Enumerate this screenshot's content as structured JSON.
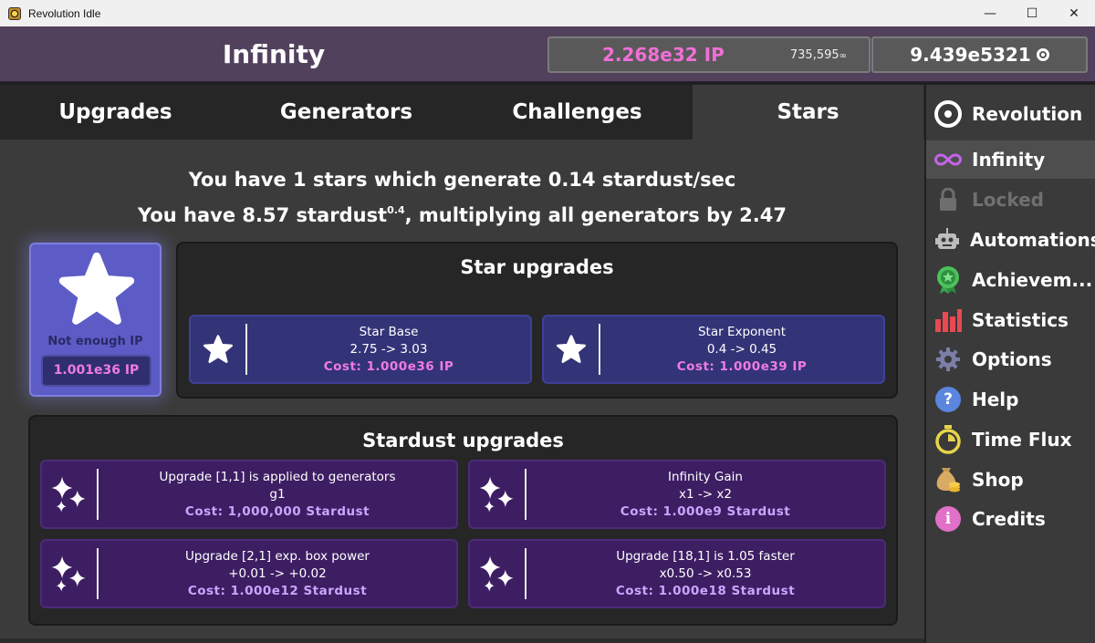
{
  "window": {
    "title": "Revolution Idle",
    "minimize": "—",
    "maximize": "☐",
    "close": "✕"
  },
  "header": {
    "title": "Infinity",
    "ip_amount": "2.268e32 IP",
    "ip_rate": "735,595",
    "ip_rate_suffix": "∞",
    "revolution_amount": "9.439e5321"
  },
  "tabs": [
    {
      "label": "Upgrades",
      "active": false
    },
    {
      "label": "Generators",
      "active": false
    },
    {
      "label": "Challenges",
      "active": false
    },
    {
      "label": "Stars",
      "active": true
    }
  ],
  "stars": {
    "line1": {
      "prefix": "You have ",
      "count": "1 stars",
      "mid": " which generate ",
      "rate": "0.14 stardust/sec"
    },
    "line2": {
      "prefix": "You have ",
      "amount": "8.57 stardust",
      "exp": "0.4",
      "mid": ", multiplying all generators by ",
      "mult": "2.47"
    },
    "buy": {
      "status": "Not enough IP",
      "cost": "1.001e36 IP"
    }
  },
  "star_upgrades": {
    "title": "Star upgrades",
    "items": [
      {
        "name": "Star Base",
        "effect": "2.75 -> 3.03",
        "cost": "Cost: 1.000e36 IP"
      },
      {
        "name": "Star Exponent",
        "effect": "0.4 -> 0.45",
        "cost": "Cost: 1.000e39 IP"
      }
    ]
  },
  "stardust_upgrades": {
    "title": "Stardust upgrades",
    "items": [
      {
        "name": "Upgrade [1,1] is applied to generators",
        "effect": "g1",
        "cost": "Cost: 1,000,000 Stardust"
      },
      {
        "name": "Infinity Gain",
        "effect": "x1 -> x2",
        "cost": "Cost: 1.000e9 Stardust"
      },
      {
        "name": "Upgrade [2,1] exp. box power",
        "effect": "+0.01 -> +0.02",
        "cost": "Cost: 1.000e12 Stardust"
      },
      {
        "name": "Upgrade [18,1] is 1.05 faster",
        "effect": "x0.50 -> x0.53",
        "cost": "Cost: 1.000e18 Stardust"
      }
    ]
  },
  "sidebar": {
    "items": [
      {
        "label": "Revolution",
        "icon": "ring-icon"
      },
      {
        "label": "Infinity",
        "icon": "infinity-icon",
        "active": true
      },
      {
        "label": "Locked",
        "icon": "lock-icon",
        "locked": true
      },
      {
        "label": "Automations",
        "icon": "robot-icon"
      },
      {
        "label": "Achievem...",
        "icon": "medal-icon"
      },
      {
        "label": "Statistics",
        "icon": "bar-chart-icon"
      },
      {
        "label": "Options",
        "icon": "gear-icon"
      },
      {
        "label": "Help",
        "icon": "help-icon"
      },
      {
        "label": "Time Flux",
        "icon": "stopwatch-icon"
      },
      {
        "label": "Shop",
        "icon": "money-bag-icon"
      },
      {
        "label": "Credits",
        "icon": "info-icon"
      }
    ]
  },
  "colors": {
    "ip_pink": "#f06fd6",
    "header_purple": "#52415c",
    "star_card": "#333378",
    "dust_card": "#3d1e63",
    "stardust_cost": "#c9a6ff"
  }
}
